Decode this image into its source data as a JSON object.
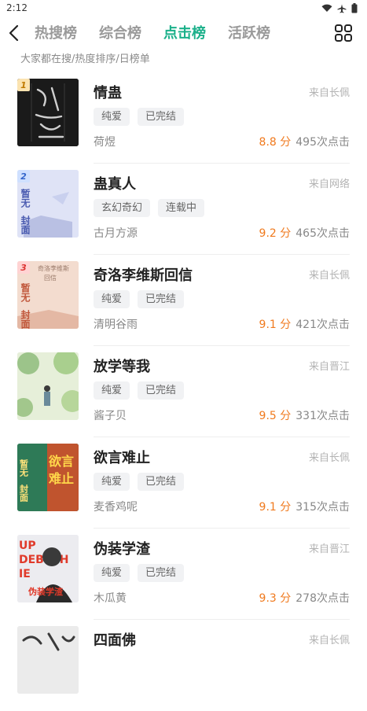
{
  "status": {
    "time": "2:12"
  },
  "nav": {
    "tabs": [
      {
        "label": "热搜榜"
      },
      {
        "label": "综合榜"
      },
      {
        "label": "点击榜"
      },
      {
        "label": "活跃榜"
      }
    ],
    "active_tab": 2
  },
  "subtitle": "大家都在搜/热度排序/日榜单",
  "colors": {
    "accent": "#1bb08a",
    "score": "#f07a1e",
    "rank1": "#f5a623",
    "rank2": "#4a7fe0",
    "rank3": "#e04a4a"
  },
  "books": [
    {
      "rank": "1",
      "title": "情蛊",
      "source": "来自长佩",
      "tags": [
        "纯爱",
        "已完结"
      ],
      "author": "荷煜",
      "score": "8.8 分",
      "clicks": "495次点击"
    },
    {
      "rank": "2",
      "title": "蛊真人",
      "source": "来自网络",
      "tags": [
        "玄幻奇幻",
        "连载中"
      ],
      "author": "古月方源",
      "score": "9.2 分",
      "clicks": "465次点击"
    },
    {
      "rank": "3",
      "title": "奇洛李维斯回信",
      "source": "来自长佩",
      "tags": [
        "纯爱",
        "已完结"
      ],
      "author": "清明谷雨",
      "score": "9.1 分",
      "clicks": "421次点击"
    },
    {
      "rank": "",
      "title": "放学等我",
      "source": "来自晋江",
      "tags": [
        "纯爱",
        "已完结"
      ],
      "author": "酱子贝",
      "score": "9.5 分",
      "clicks": "331次点击"
    },
    {
      "rank": "",
      "title": "欲言难止",
      "source": "来自长佩",
      "tags": [
        "纯爱",
        "已完结"
      ],
      "author": "麦香鸡呢",
      "score": "9.1 分",
      "clicks": "315次点击"
    },
    {
      "rank": "",
      "title": "伪装学渣",
      "source": "来自晋江",
      "tags": [
        "纯爱",
        "已完结"
      ],
      "author": "木瓜黄",
      "score": "9.3 分",
      "clicks": "278次点击"
    },
    {
      "rank": "",
      "title": "四面佛",
      "source": "来自长佩",
      "tags": [],
      "author": "",
      "score": "",
      "clicks": ""
    }
  ],
  "covers": {
    "placeholder_text": "暂无封面",
    "cover3_subtitle": "奇洛李维斯回信",
    "cover1_text": "情蛊",
    "cover5_text": "欲言难止",
    "cover6_text": "伪装学渣"
  }
}
